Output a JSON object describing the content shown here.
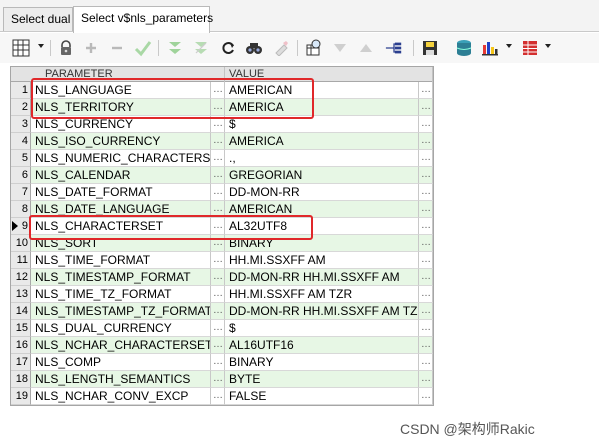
{
  "tabs": [
    {
      "label": "Select dual"
    },
    {
      "label": "Select v$nls_parameters"
    }
  ],
  "toolbar": {
    "icons": [
      "grid-view-icon",
      "lock-icon",
      "add-record-icon",
      "delete-record-icon",
      "post-edit-icon",
      "filter-icon",
      "clear-filter-icon",
      "refresh-icon",
      "find-icon",
      "clear-icon",
      "query-by-example-icon",
      "sort-desc-icon",
      "sort-asc-icon",
      "export-icon",
      "save-icon",
      "database-icon",
      "chart-icon",
      "table-icon"
    ]
  },
  "grid": {
    "columns": [
      "PARAMETER",
      "VALUE"
    ],
    "ellipsis": "…",
    "rows": [
      {
        "n": "1",
        "parameter": "NLS_LANGUAGE",
        "value": "AMERICAN"
      },
      {
        "n": "2",
        "parameter": "NLS_TERRITORY",
        "value": "AMERICA"
      },
      {
        "n": "3",
        "parameter": "NLS_CURRENCY",
        "value": "$"
      },
      {
        "n": "4",
        "parameter": "NLS_ISO_CURRENCY",
        "value": "AMERICA"
      },
      {
        "n": "5",
        "parameter": "NLS_NUMERIC_CHARACTERS",
        "value": ".,"
      },
      {
        "n": "6",
        "parameter": "NLS_CALENDAR",
        "value": "GREGORIAN"
      },
      {
        "n": "7",
        "parameter": "NLS_DATE_FORMAT",
        "value": "DD-MON-RR"
      },
      {
        "n": "8",
        "parameter": "NLS_DATE_LANGUAGE",
        "value": "AMERICAN"
      },
      {
        "n": "9",
        "parameter": "NLS_CHARACTERSET",
        "value": "AL32UTF8"
      },
      {
        "n": "10",
        "parameter": "NLS_SORT",
        "value": "BINARY"
      },
      {
        "n": "11",
        "parameter": "NLS_TIME_FORMAT",
        "value": "HH.MI.SSXFF AM"
      },
      {
        "n": "12",
        "parameter": "NLS_TIMESTAMP_FORMAT",
        "value": "DD-MON-RR HH.MI.SSXFF AM"
      },
      {
        "n": "13",
        "parameter": "NLS_TIME_TZ_FORMAT",
        "value": "HH.MI.SSXFF AM TZR"
      },
      {
        "n": "14",
        "parameter": "NLS_TIMESTAMP_TZ_FORMAT",
        "value": "DD-MON-RR HH.MI.SSXFF AM TZR"
      },
      {
        "n": "15",
        "parameter": "NLS_DUAL_CURRENCY",
        "value": "$"
      },
      {
        "n": "16",
        "parameter": "NLS_NCHAR_CHARACTERSET",
        "value": "AL16UTF16"
      },
      {
        "n": "17",
        "parameter": "NLS_COMP",
        "value": "BINARY"
      },
      {
        "n": "18",
        "parameter": "NLS_LENGTH_SEMANTICS",
        "value": "BYTE"
      },
      {
        "n": "19",
        "parameter": "NLS_NCHAR_CONV_EXCP",
        "value": "FALSE"
      }
    ]
  },
  "watermark": "CSDN @架构师Rakic",
  "colors": {
    "accent_red": "#e0282a",
    "row_green": "#e7f7e5"
  }
}
